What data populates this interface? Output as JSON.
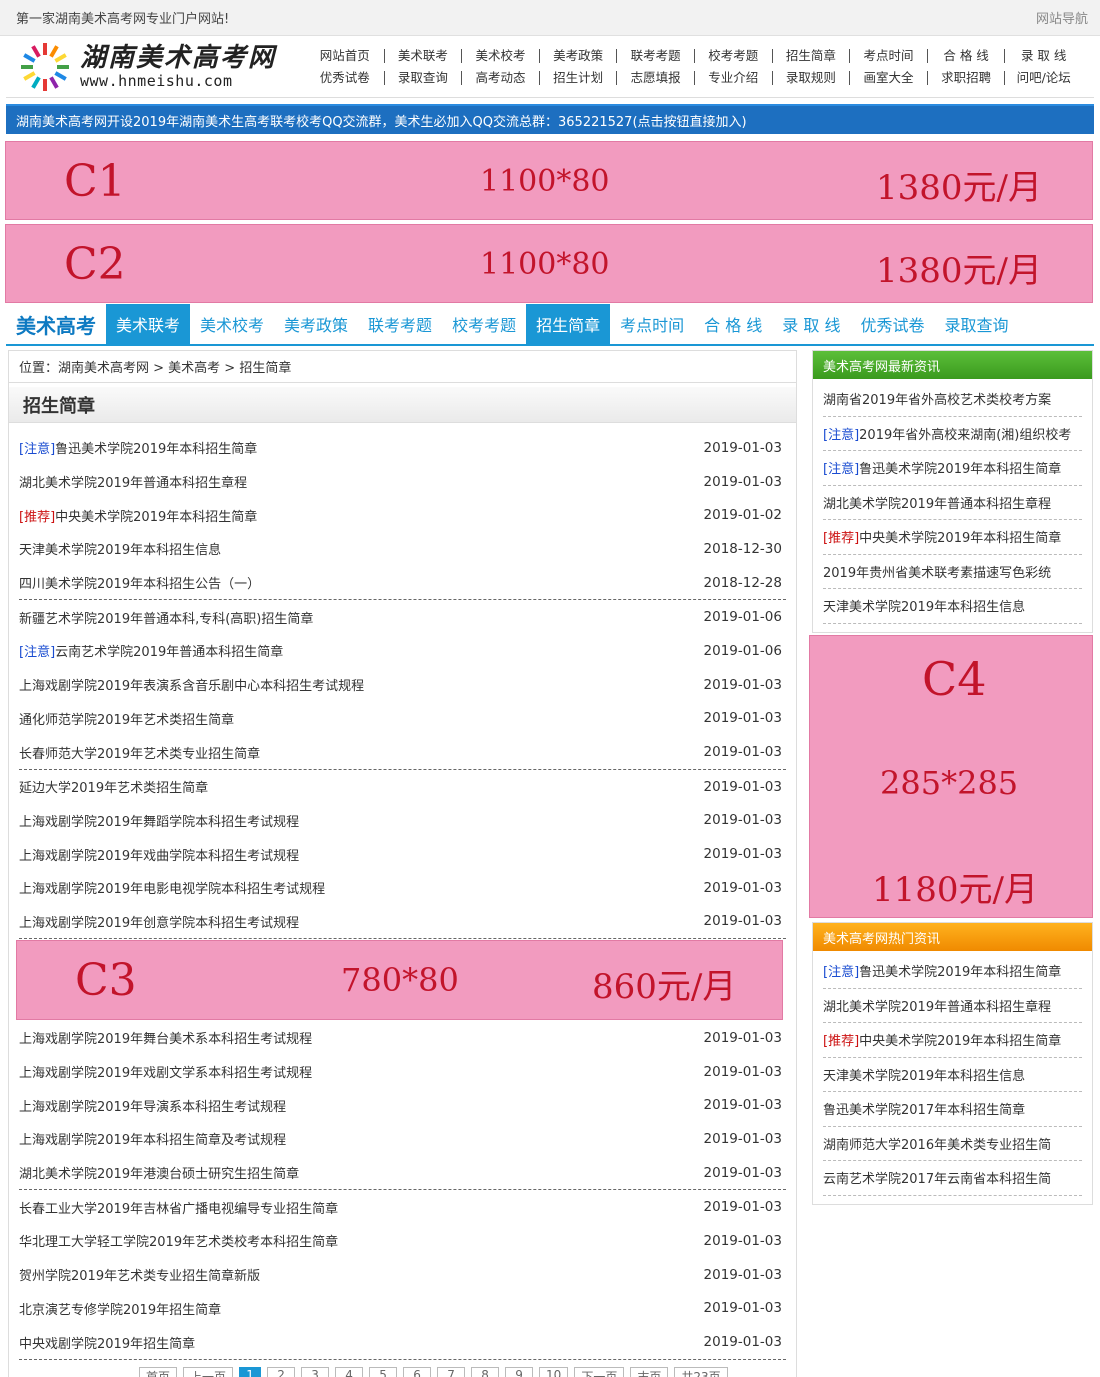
{
  "topbar": {
    "slogan": "第一家湖南美术高考网专业门户网站!",
    "nav": "网站导航"
  },
  "logo": {
    "title": "湖南美术高考网",
    "url": "www.hnmeishu.com"
  },
  "topnav": {
    "row1": [
      "网站首页",
      "美术联考",
      "美术校考",
      "美考政策",
      "联考考题",
      "校考考题",
      "招生简章",
      "考点时间",
      "合 格 线",
      "录 取 线"
    ],
    "row2": [
      "优秀试卷",
      "录取查询",
      "高考动态",
      "招生计划",
      "志愿填报",
      "专业介绍",
      "录取规则",
      "画室大全",
      "求职招聘",
      "问吧/论坛"
    ]
  },
  "notice": "湖南美术高考网开设2019年湖南美术生高考联考校考QQ交流群，美术生必加入QQ交流总群：365221527(点击按钮直接加入)",
  "ads": {
    "c1": {
      "code": "C1",
      "size": "1100*80",
      "price": "1380元/月"
    },
    "c2": {
      "code": "C2",
      "size": "1100*80",
      "price": "1380元/月"
    },
    "c3": {
      "code": "C3",
      "size": "780*80",
      "price": "860元/月"
    },
    "c4": {
      "code": "C4",
      "size": "285*285",
      "price": "1180元/月"
    }
  },
  "channel": {
    "title": "美术高考",
    "tabs": [
      "美术联考",
      "美术校考",
      "美考政策",
      "联考考题",
      "校考考题",
      "招生简章",
      "考点时间",
      "合 格 线",
      "录 取 线",
      "优秀试卷",
      "录取查询"
    ]
  },
  "breadcrumb": "位置：湖南美术高考网 > 美术高考 > 招生简章",
  "section_title": "招生简章",
  "list1": [
    {
      "tag": "[注意]",
      "title": "鲁迅美术学院2019年本科招生简章",
      "date": "2019-01-03"
    },
    {
      "tag": "",
      "title": "湖北美术学院2019年普通本科招生章程",
      "date": "2019-01-03"
    },
    {
      "tag": "[推荐]",
      "title": "中央美术学院2019年本科招生简章",
      "date": "2019-01-02"
    },
    {
      "tag": "",
      "title": "天津美术学院2019年本科招生信息",
      "date": "2018-12-30"
    },
    {
      "tag": "",
      "title": "四川美术学院2019年本科招生公告（一）",
      "date": "2018-12-28"
    },
    {
      "tag": "",
      "title": "新疆艺术学院2019年普通本科,专科(高职)招生简章",
      "date": "2019-01-06"
    },
    {
      "tag": "[注意]",
      "title": "云南艺术学院2019年普通本科招生简章",
      "date": "2019-01-06"
    },
    {
      "tag": "",
      "title": "上海戏剧学院2019年表演系含音乐剧中心本科招生考试规程",
      "date": "2019-01-03"
    },
    {
      "tag": "",
      "title": "通化师范学院2019年艺术类招生简章",
      "date": "2019-01-03"
    },
    {
      "tag": "",
      "title": "长春师范大学2019年艺术类专业招生简章",
      "date": "2019-01-03"
    },
    {
      "tag": "",
      "title": "延边大学2019年艺术类招生简章",
      "date": "2019-01-03"
    },
    {
      "tag": "",
      "title": "上海戏剧学院2019年舞蹈学院本科招生考试规程",
      "date": "2019-01-03"
    },
    {
      "tag": "",
      "title": "上海戏剧学院2019年戏曲学院本科招生考试规程",
      "date": "2019-01-03"
    },
    {
      "tag": "",
      "title": "上海戏剧学院2019年电影电视学院本科招生考试规程",
      "date": "2019-01-03"
    },
    {
      "tag": "",
      "title": "上海戏剧学院2019年创意学院本科招生考试规程",
      "date": "2019-01-03"
    }
  ],
  "list2": [
    {
      "title": "上海戏剧学院2019年舞台美术系本科招生考试规程",
      "date": "2019-01-03"
    },
    {
      "title": "上海戏剧学院2019年戏剧文学系本科招生考试规程",
      "date": "2019-01-03"
    },
    {
      "title": "上海戏剧学院2019年导演系本科招生考试规程",
      "date": "2019-01-03"
    },
    {
      "title": "上海戏剧学院2019年本科招生简章及考试规程",
      "date": "2019-01-03"
    },
    {
      "title": "湖北美术学院2019年港澳台硕士研究生招生简章",
      "date": "2019-01-03"
    },
    {
      "title": "长春工业大学2019年吉林省广播电视编导专业招生简章",
      "date": "2019-01-03"
    },
    {
      "title": "华北理工大学轻工学院2019年艺术类校考本科招生简章",
      "date": "2019-01-03"
    },
    {
      "title": "贺州学院2019年艺术类专业招生简章新版",
      "date": "2019-01-03"
    },
    {
      "title": "北京演艺专修学院2019年招生简章",
      "date": "2019-01-03"
    },
    {
      "title": "中央戏剧学院2019年招生简章",
      "date": "2019-01-03"
    }
  ],
  "pager": [
    "首页",
    "上一页",
    "1",
    "2",
    "3",
    "4",
    "5",
    "6",
    "7",
    "8",
    "9",
    "10",
    "下一页",
    "末页",
    "共23页"
  ],
  "latest": {
    "title": "美术高考网最新资讯",
    "items": [
      {
        "tag": "",
        "title": "湖南省2019年省外高校艺术类校考方案"
      },
      {
        "tag": "[注意]",
        "title": "2019年省外高校来湖南(湘)组织校考"
      },
      {
        "tag": "[注意]",
        "title": "鲁迅美术学院2019年本科招生简章"
      },
      {
        "tag": "",
        "title": "湖北美术学院2019年普通本科招生章程"
      },
      {
        "tag": "[推荐]",
        "title": "中央美术学院2019年本科招生简章"
      },
      {
        "tag": "",
        "title": "2019年贵州省美术联考素描速写色彩统"
      },
      {
        "tag": "",
        "title": "天津美术学院2019年本科招生信息"
      }
    ]
  },
  "hot": {
    "title": "美术高考网热门资讯",
    "items": [
      {
        "tag": "[注意]",
        "title": "鲁迅美术学院2019年本科招生简章"
      },
      {
        "tag": "",
        "title": "湖北美术学院2019年普通本科招生章程"
      },
      {
        "tag": "[推荐]",
        "title": "中央美术学院2019年本科招生简章"
      },
      {
        "tag": "",
        "title": "天津美术学院2019年本科招生信息"
      },
      {
        "tag": "",
        "title": "鲁迅美术学院2017年本科招生简章"
      },
      {
        "tag": "",
        "title": "湖南师范大学2016年美术类专业招生简"
      },
      {
        "tag": "",
        "title": "云南艺术学院2017年云南省本科招生简"
      }
    ]
  }
}
